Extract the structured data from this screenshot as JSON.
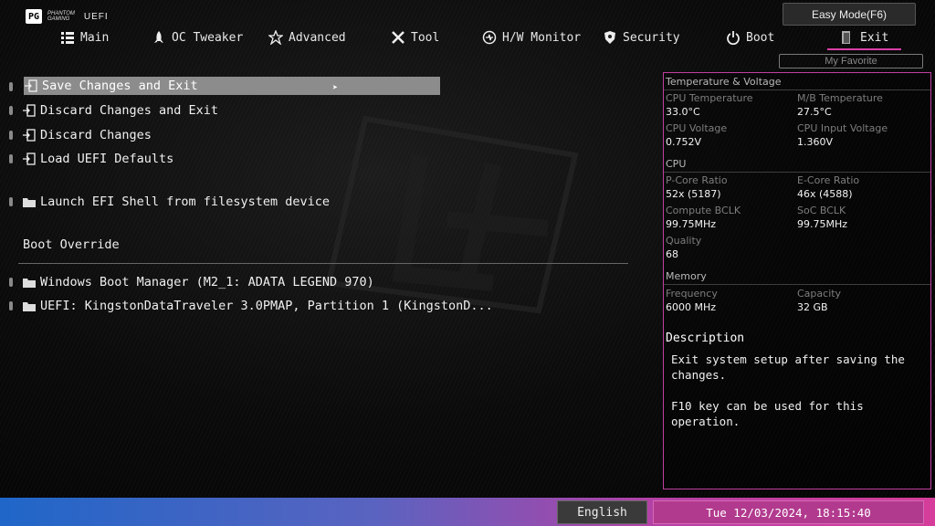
{
  "brand": {
    "line1": "PHANTOM",
    "line2": "GAMING",
    "product": "UEFI",
    "mark": "PG"
  },
  "easy_mode": {
    "label": "Easy Mode(F6)"
  },
  "tabs": [
    {
      "label": "Main",
      "icon": "list-icon"
    },
    {
      "label": "OC Tweaker",
      "icon": "rocket-icon"
    },
    {
      "label": "Advanced",
      "icon": "star-icon"
    },
    {
      "label": "Tool",
      "icon": "tools-icon"
    },
    {
      "label": "H/W Monitor",
      "icon": "monitor-icon"
    },
    {
      "label": "Security",
      "icon": "shield-icon"
    },
    {
      "label": "Boot",
      "icon": "power-icon"
    },
    {
      "label": "Exit",
      "icon": "exit-door-icon",
      "active": true
    }
  ],
  "my_favorite": {
    "label": "My Favorite"
  },
  "menu": {
    "items": [
      {
        "label": "Save Changes and Exit",
        "selected": true
      },
      {
        "label": "Discard Changes and Exit"
      },
      {
        "label": "Discard Changes"
      },
      {
        "label": "Load UEFI Defaults"
      },
      {
        "label": "Launch EFI Shell from filesystem device"
      }
    ],
    "boot_override_title": "Boot Override",
    "boot_items": [
      {
        "label": "Windows Boot Manager (M2_1: ADATA LEGEND 970)"
      },
      {
        "label": "UEFI: KingstonDataTraveler 3.0PMAP, Partition 1 (KingstonD..."
      }
    ]
  },
  "panel": {
    "temp_title": "Temperature & Voltage",
    "cpu_temp_label": "CPU Temperature",
    "cpu_temp": "33.0°C",
    "mb_temp_label": "M/B Temperature",
    "mb_temp": "27.5°C",
    "cpu_volt_label": "CPU Voltage",
    "cpu_volt": "0.752V",
    "cpu_in_volt_label": "CPU Input Voltage",
    "cpu_in_volt": "1.360V",
    "cpu_title": "CPU",
    "pcore_label": "P-Core Ratio",
    "pcore": "52x (5187)",
    "ecore_label": "E-Core Ratio",
    "ecore": "46x (4588)",
    "compute_bclk_label": "Compute BCLK",
    "compute_bclk": "99.75MHz",
    "soc_bclk_label": "SoC BCLK",
    "soc_bclk": "99.75MHz",
    "quality_label": "Quality",
    "quality": "68",
    "memory_title": "Memory",
    "freq_label": "Frequency",
    "freq": "6000 MHz",
    "cap_label": "Capacity",
    "cap": "32 GB",
    "desc_title": "Description",
    "desc_body": "Exit system setup after saving the\nchanges.\n\nF10 key can be used for this operation."
  },
  "footer": {
    "language": "English",
    "datetime": "Tue 12/03/2024, 18:15:40"
  },
  "colors": {
    "accent": "#d93fa8",
    "selected_row": "#8c8c8c",
    "panel_border": "#c03fa0"
  }
}
